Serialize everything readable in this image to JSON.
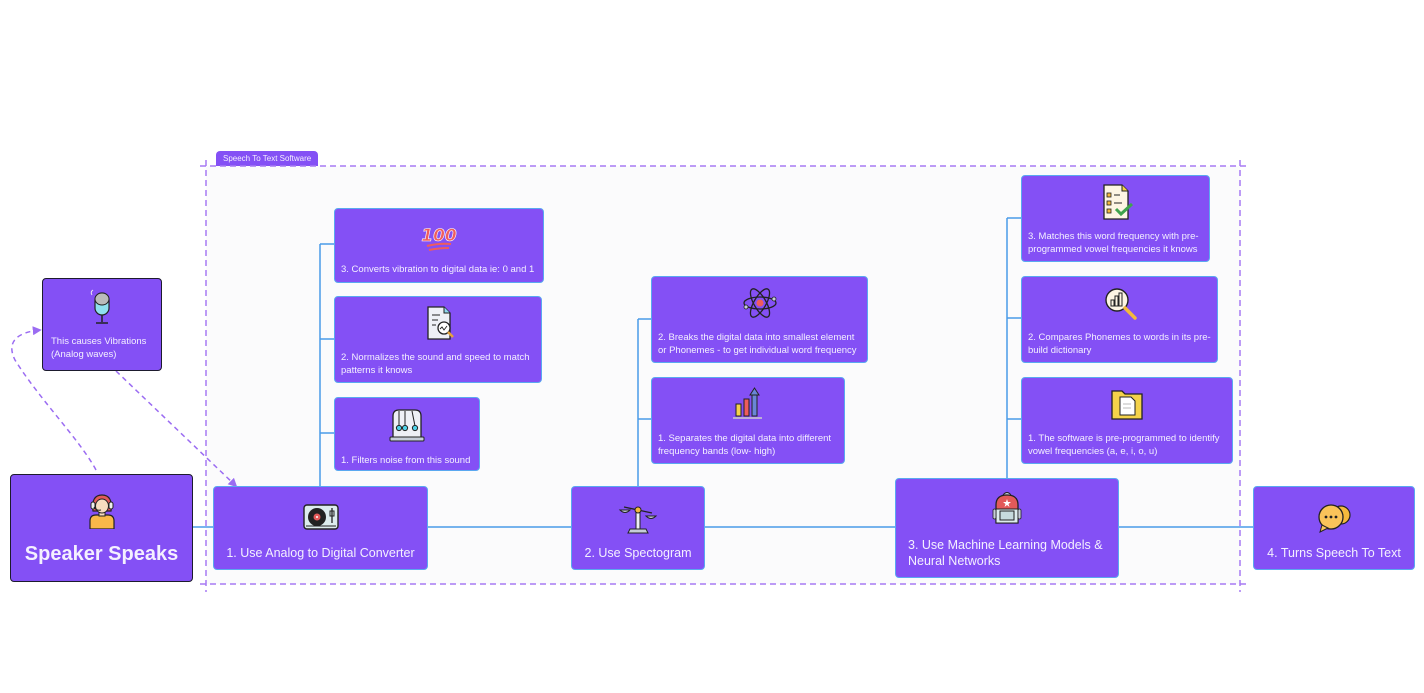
{
  "colors": {
    "node_fill": "#8450f5",
    "node_border": "#5aa8f0",
    "connector": "#4a9be8",
    "frame_dash": "#9b6cf2",
    "frame_bg": "#fbfbfc",
    "node_text": "#f4f0ff"
  },
  "frame": {
    "label": "Speech To Text Software"
  },
  "nodes": {
    "speaker": {
      "label": "Speaker Speaks",
      "icon": "headset-person-icon"
    },
    "vibrations": {
      "label": "This causes Vibrations (Analog waves)",
      "icon": "microphone-icon"
    },
    "adc": {
      "label": "1. Use Analog to Digital Converter",
      "icon": "turntable-icon",
      "children": [
        {
          "label": "3. Converts vibration to digital data ie: 0 and 1",
          "icon": "hundred-points-icon"
        },
        {
          "label": "2. Normalizes the sound and speed to match patterns it knows",
          "icon": "document-analysis-icon"
        },
        {
          "label": "1. Filters noise from this sound",
          "icon": "newtons-cradle-icon"
        }
      ]
    },
    "spectogram": {
      "label": "2. Use Spectogram",
      "icon": "balance-scale-icon",
      "children": [
        {
          "label": "2. Breaks the digital data into smallest element or Phonemes - to get individual word frequency",
          "icon": "atom-icon"
        },
        {
          "label": "1. Separates the digital data into different frequency bands (low- high)",
          "icon": "bar-chart-growth-icon"
        }
      ]
    },
    "ml": {
      "label": "3. Use Machine Learning Models & Neural Networks",
      "icon": "backpack-icon",
      "children": [
        {
          "label": "3. Matches this word frequency with pre-programmed vowel frequencies it knows",
          "icon": "checklist-icon"
        },
        {
          "label": "2. Compares Phonemes to words in its pre-build dictionary",
          "icon": "search-chart-icon"
        },
        {
          "label": "1. The software is pre-programmed to identify vowel frequencies (a, e, i, o, u)",
          "icon": "folder-file-icon"
        }
      ]
    },
    "output": {
      "label": "4. Turns Speech To Text",
      "icon": "chat-bubbles-icon"
    }
  }
}
